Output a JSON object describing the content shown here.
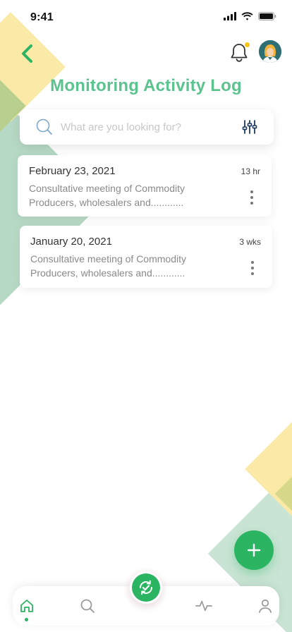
{
  "status_bar": {
    "time": "9:41"
  },
  "header": {
    "title": "Monitoring Activity Log"
  },
  "search": {
    "placeholder": "What are you looking for?"
  },
  "activities": [
    {
      "date": "February 23, 2021",
      "time_ago": "13 hr",
      "description": "Consultative meeting of Commodity Producers, wholesalers and............"
    },
    {
      "date": "January 20, 2021",
      "time_ago": "3 wks",
      "description": "Consultative meeting of Commodity Producers, wholesalers and............"
    }
  ],
  "bottom_nav": {
    "items": [
      "home-icon",
      "search-icon",
      "sync-check-icon",
      "activity-icon",
      "user-icon"
    ],
    "active": "home-icon"
  },
  "colors": {
    "accent": "#2bb563",
    "title": "#5cc38e",
    "notification_dot": "#f5c518"
  }
}
